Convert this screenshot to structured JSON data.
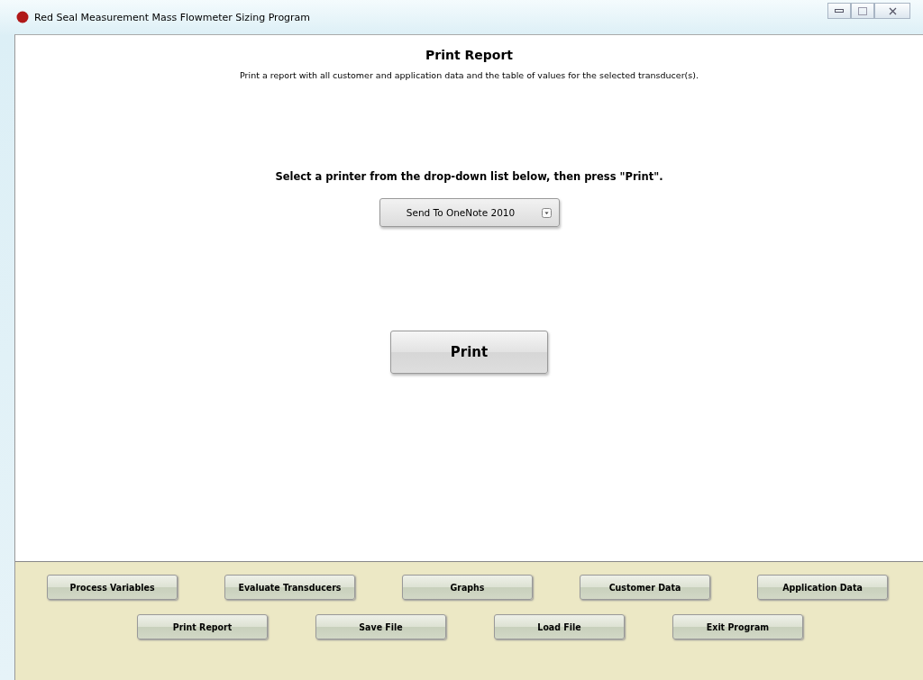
{
  "window": {
    "title": "Red Seal Measurement Mass Flowmeter Sizing Program"
  },
  "page": {
    "heading": "Print Report",
    "description": "Print a report with all customer and application data and the table of values for the selected transducer(s).",
    "instruction": "Select a printer from the drop-down list below, then press \"Print\".",
    "printer": "Send To OneNote 2010",
    "print_button": "Print"
  },
  "nav_rows": [
    [
      "Process Variables",
      "Evaluate Transducers",
      "Graphs",
      "Customer Data",
      "Application Data"
    ],
    [
      "Print Report",
      "Save File",
      "Load File",
      "Exit Program"
    ]
  ]
}
